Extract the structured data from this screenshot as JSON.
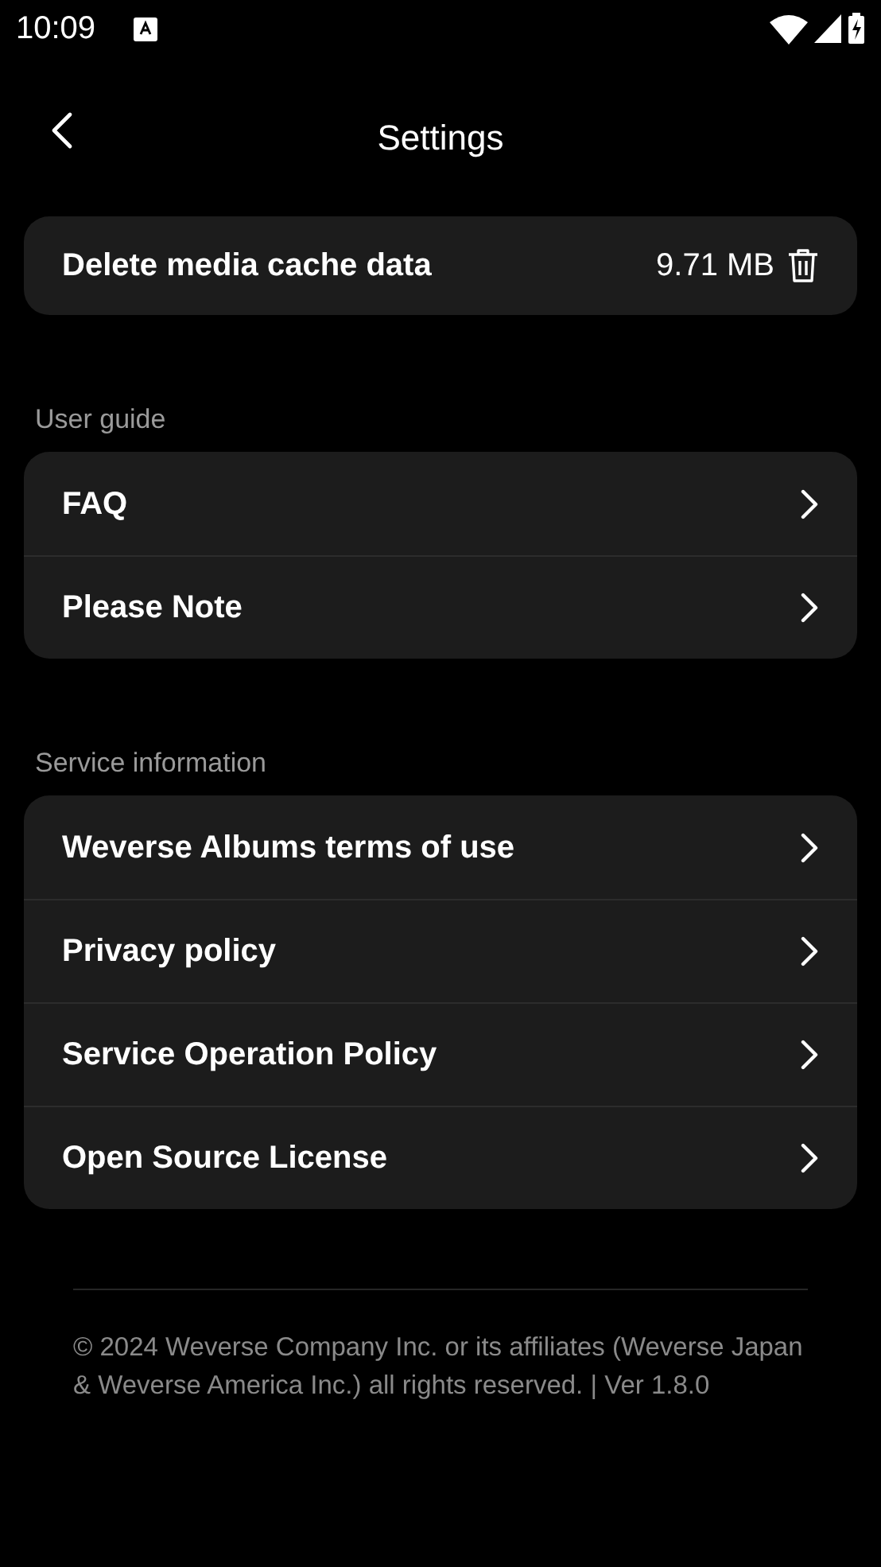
{
  "status_bar": {
    "time": "10:09"
  },
  "header": {
    "title": "Settings"
  },
  "cache": {
    "label": "Delete media cache data",
    "size": "9.71 MB"
  },
  "sections": [
    {
      "title": "User guide",
      "items": [
        {
          "label": "FAQ"
        },
        {
          "label": "Please Note"
        }
      ]
    },
    {
      "title": "Service information",
      "items": [
        {
          "label": "Weverse Albums terms of use"
        },
        {
          "label": "Privacy policy"
        },
        {
          "label": "Service Operation Policy"
        },
        {
          "label": "Open Source License"
        }
      ]
    }
  ],
  "footer": "© 2024 Weverse Company Inc. or its affiliates (Weverse Japan & Weverse America Inc.) all rights reserved. | Ver 1.8.0"
}
